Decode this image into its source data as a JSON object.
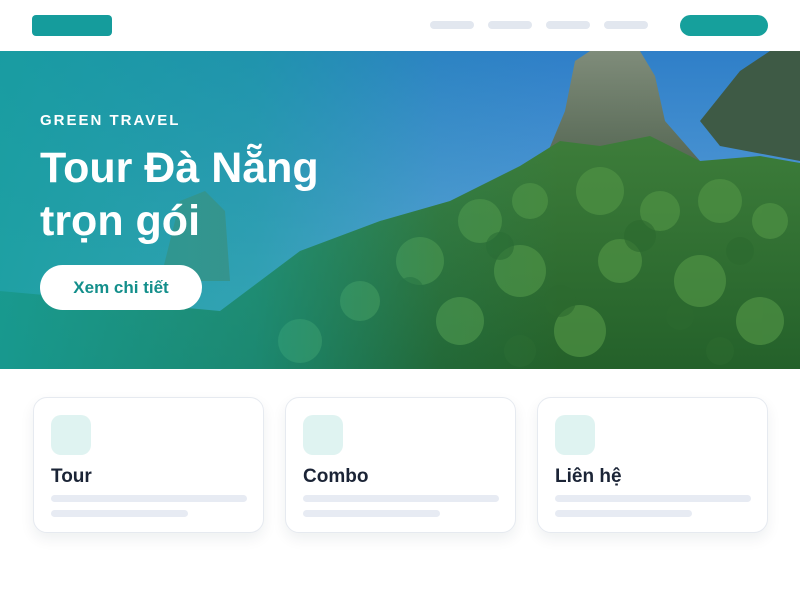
{
  "hero": {
    "eyebrow": "GREEN TRAVEL",
    "title": "Tour Đà Nẵng trọn gói",
    "button_label": "Xem chi tiết"
  },
  "cards": [
    {
      "title": "Tour"
    },
    {
      "title": "Combo"
    },
    {
      "title": "Liên hệ"
    }
  ],
  "colors": {
    "accent": "#16a09c",
    "icon_bg": "#dff3f1",
    "skeleton": "#e2e7ef",
    "text_dark": "#1b2436"
  }
}
